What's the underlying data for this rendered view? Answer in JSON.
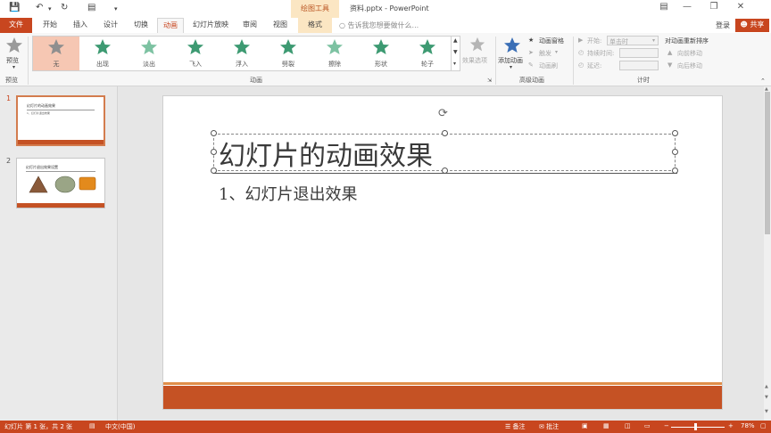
{
  "window": {
    "title": "资料.pptx - PowerPoint",
    "context_tool": "绘图工具",
    "colors": {
      "accent": "#c8461f",
      "context_bg": "#fbe6c3",
      "slide_bar": "#c55224"
    }
  },
  "tabs": {
    "file": "文件",
    "items": [
      "开始",
      "插入",
      "设计",
      "切换",
      "动画",
      "幻灯片放映",
      "审阅",
      "视图",
      "格式"
    ],
    "active": "动画",
    "tellme": "告诉我您想要做什么...",
    "login": "登录",
    "share": "共享"
  },
  "ribbon": {
    "preview": {
      "label": "预览",
      "group": "预览"
    },
    "animation_gallery": {
      "group": "动画",
      "items": [
        {
          "label": "无",
          "icon": "star-icon-gray",
          "selected": true
        },
        {
          "label": "出现",
          "icon": "star-icon-green"
        },
        {
          "label": "淡出",
          "icon": "star-icon-green"
        },
        {
          "label": "飞入",
          "icon": "star-icon-green"
        },
        {
          "label": "浮入",
          "icon": "star-icon-green"
        },
        {
          "label": "劈裂",
          "icon": "star-icon-green"
        },
        {
          "label": "擦除",
          "icon": "star-icon-green"
        },
        {
          "label": "形状",
          "icon": "star-icon-green"
        },
        {
          "label": "轮子",
          "icon": "star-icon-green"
        }
      ],
      "effect_options": "效果选项"
    },
    "advanced": {
      "group": "高级动画",
      "add_animation": "添加动画",
      "animation_pane": "动画窗格",
      "trigger": "触发",
      "painter": "动画刷"
    },
    "timing": {
      "group": "计时",
      "start_label": "开始:",
      "start_value": "单击时",
      "duration_label": "持续时间:",
      "delay_label": "延迟:",
      "reorder": "对动画重新排序",
      "move_earlier": "向前移动",
      "move_later": "向后移动"
    }
  },
  "thumbnails": [
    {
      "number": "1",
      "title": "幻灯片的动画效果",
      "body": "1、幻灯片退出效果",
      "selected": true
    },
    {
      "number": "2",
      "title": "幻灯片退出效果设置",
      "shapes": [
        "triangle",
        "ellipse",
        "rounded-rect"
      ]
    }
  ],
  "slide": {
    "title": "幻灯片的动画效果",
    "body": "1、幻灯片退出效果"
  },
  "status": {
    "slide_info": "幻灯片 第 1 张，共 2 张",
    "language": "中文(中国)",
    "notes": "备注",
    "comments": "批注",
    "zoom": "78%"
  }
}
